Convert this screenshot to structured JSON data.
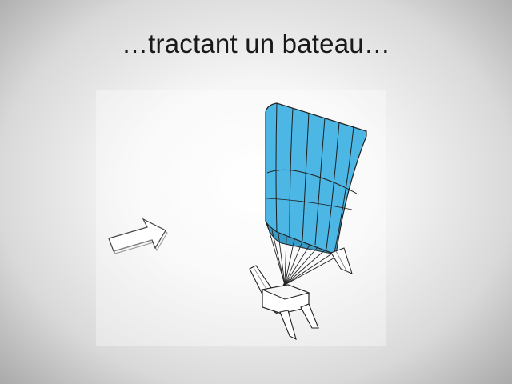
{
  "slide": {
    "title": "…tractant un bateau…"
  },
  "illustration": {
    "kite_color": "#4cb6e4",
    "outline_color": "#222222",
    "arrow_fill": "#ffffff",
    "icons": [
      "wind-arrow-icon",
      "kite-sail",
      "catamaran-boat"
    ]
  }
}
